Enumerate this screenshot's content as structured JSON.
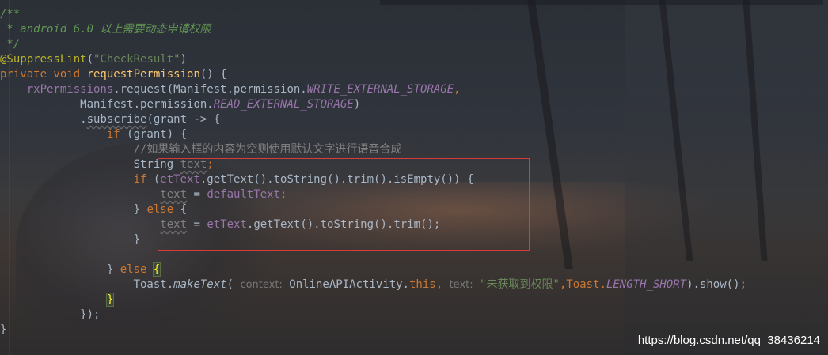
{
  "code": {
    "l1": "/**",
    "l2": " * android 6.0 以上需要动态申请权限",
    "l3": " */",
    "l4_ann": "@SuppressLint",
    "l4_p1": "(",
    "l4_str": "\"CheckResult\"",
    "l4_p2": ")",
    "l5_kw": "private void ",
    "l5_fn": "requestPermission",
    "l5_rest": "() {",
    "l6_ind": "    ",
    "l6_fld": "rxPermissions",
    "l6_mid": ".request(Manifest.permission.",
    "l6_sfld": "WRITE_EXTERNAL_STORAGE",
    "l6_end": ",",
    "l7_ind": "            ",
    "l7_mid": "Manifest.permission.",
    "l7_sfld": "READ_EXTERNAL_STORAGE",
    "l7_end": ")",
    "l8_ind": "            ",
    "l8_a": ".",
    "l8_b": "subscribe",
    "l8_c": "(grant -> {",
    "l9_ind": "                ",
    "l9_kw": "if",
    "l9_rest": " (grant) {",
    "l10_ind": "                    ",
    "l10_cmt": "//如果输入框的内容为空则使用默认文字进行语音合成",
    "l11_ind": "                    ",
    "l11_type": "String ",
    "l11_var": "text",
    "l11_end": ";",
    "l12_ind": "                    ",
    "l12_kw": "if",
    "l12_a": " (",
    "l12_fld": "etText",
    "l12_rest": ".getText().toString().trim().isEmpty()) {",
    "l13_ind": "                        ",
    "l13_var": "text",
    "l13_eq": " = ",
    "l13_fld": "defaultText",
    "l13_end": ";",
    "l14_ind": "                    ",
    "l14_a": "} ",
    "l14_kw": "else",
    "l14_b": " {",
    "l15_ind": "                        ",
    "l15_var": "text",
    "l15_eq": " = ",
    "l15_fld": "etText",
    "l15_rest": ".getText().toString().trim();",
    "l16_ind": "                    ",
    "l16": "}",
    "l17": "",
    "l18_ind": "                ",
    "l18_a": "} ",
    "l18_kw": "else ",
    "l18_brace": "{",
    "l19_ind": "                    ",
    "l19_a": "Toast.",
    "l19_meth": "makeText",
    "l19_b": "( ",
    "l19_hint1": "context:",
    "l19_c": " OnlineAPIActivity.",
    "l19_kw": "this",
    "l19_d": ", ",
    "l19_hint2": "text:",
    "l19_str": " \"未获取到权限\"",
    "l19_e": ",Toast.",
    "l19_sfld": "LENGTH_SHORT",
    "l19_f": ").show();",
    "l20_ind": "                ",
    "l20_brace": "}",
    "l21_ind": "            ",
    "l21": "});",
    "l22": "}"
  },
  "watermark": "https://blog.csdn.net/qq_38436214"
}
